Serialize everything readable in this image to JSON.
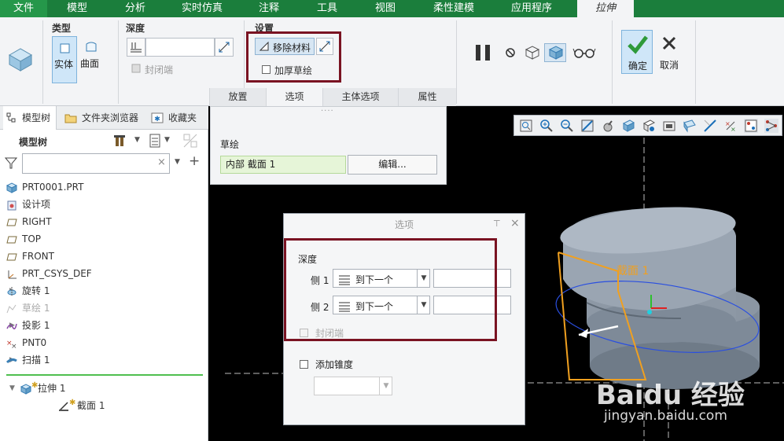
{
  "menu": {
    "tabs": [
      "文件",
      "模型",
      "分析",
      "实时仿真",
      "注释",
      "工具",
      "视图",
      "柔性建模",
      "应用程序"
    ],
    "active_tab": "拉伸"
  },
  "ribbon": {
    "type_group_label": "类型",
    "solid_label": "实体",
    "surface_label": "曲面",
    "depth_group_label": "深度",
    "depth_value": "",
    "cap_ends_label": "封闭端",
    "settings_group_label": "设置",
    "remove_material_label": "移除材料",
    "thicken_sketch_label": "加厚草绘",
    "confirm_label": "确定",
    "cancel_label": "取消",
    "sub_tabs": [
      "放置",
      "选项",
      "主体选项",
      "属性"
    ],
    "active_sub_tab": "选项"
  },
  "left_panel": {
    "tabs": [
      "模型树",
      "文件夹浏览器",
      "收藏夹"
    ],
    "active_tab": "模型树",
    "tree_header": "模型树",
    "search_placeholder": "",
    "tree": [
      {
        "label": "PRT0001.PRT",
        "icon": "part-icon",
        "expander": "",
        "dim": false
      },
      {
        "label": "设计项",
        "icon": "design-items-icon",
        "expander": "▶",
        "dim": false
      },
      {
        "label": "RIGHT",
        "icon": "datum-plane-icon",
        "expander": "",
        "dim": false
      },
      {
        "label": "TOP",
        "icon": "datum-plane-icon",
        "expander": "",
        "dim": false
      },
      {
        "label": "FRONT",
        "icon": "datum-plane-icon",
        "expander": "",
        "dim": false
      },
      {
        "label": "PRT_CSYS_DEF",
        "icon": "csys-icon",
        "expander": "",
        "dim": false
      },
      {
        "label": "旋转 1",
        "icon": "revolve-icon",
        "expander": "▶",
        "dim": false
      },
      {
        "label": "草绘 1",
        "icon": "sketch-icon",
        "expander": "",
        "dim": true
      },
      {
        "label": "投影 1",
        "icon": "projection-icon",
        "expander": "▶",
        "dim": false
      },
      {
        "label": "PNT0",
        "icon": "point-icon",
        "expander": "",
        "dim": false
      },
      {
        "label": "扫描 1",
        "icon": "sweep-icon",
        "expander": "▶",
        "dim": false
      }
    ],
    "insert_tree": [
      {
        "label": "拉伸 1",
        "icon": "extrude-icon",
        "expander": "▼"
      },
      {
        "label": "截面 1",
        "icon": "section-icon",
        "expander": ""
      }
    ]
  },
  "sketch_panel": {
    "label": "草绘",
    "section_value": "内部 截面 1",
    "edit_button": "编辑..."
  },
  "options_dialog": {
    "title": "选项",
    "depth_label": "深度",
    "side1_label": "侧 1",
    "side1_value": "到下一个",
    "side1_field": "",
    "side2_label": "侧 2",
    "side2_value": "到下一个",
    "side2_field": "",
    "cap_ends_label": "封闭端",
    "add_taper_label": "添加锥度",
    "taper_value": ""
  },
  "viewport": {
    "section_annotation": "截面 1",
    "watermark_main": "Baidu 经验",
    "watermark_url": "jingyan.baidu.com"
  },
  "colors": {
    "menu_bg": "#1b7e3c",
    "highlight_red": "#7a1322",
    "section_orange": "#f0a020"
  }
}
